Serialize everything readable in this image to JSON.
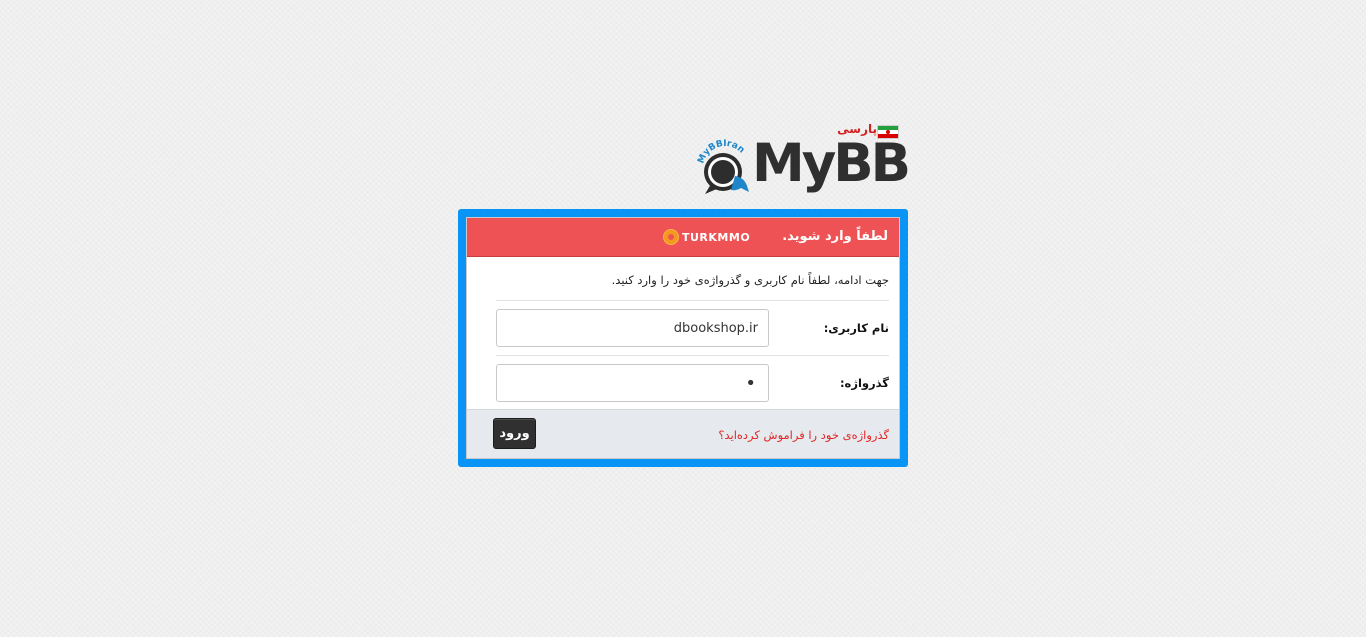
{
  "logo": {
    "text": "MyBB",
    "ring_text": "MyBBIran",
    "persian_label": "پارسی"
  },
  "login": {
    "title": "لطفاً وارد شوید.",
    "brand": "TURKMMO",
    "intro": "جهت ادامه، لطفاً نام کاربری و گذرواژه‌ی خود را وارد کنید.",
    "username": {
      "label": "نام کاربری:",
      "value": "dbookshop.ir"
    },
    "password": {
      "label": "گذرواژه:",
      "value": "•"
    },
    "forgot_link": "گذرواژه‌ی خود را فراموش کرده‌اید؟",
    "submit_label": "ورود"
  },
  "colors": {
    "frame": "#0a94f5",
    "header": "#ef5254",
    "link": "#e32626",
    "button": "#303030"
  },
  "icons": [
    "mybb-logo-icon",
    "iran-flag-icon",
    "turkmmo-brand-icon"
  ]
}
